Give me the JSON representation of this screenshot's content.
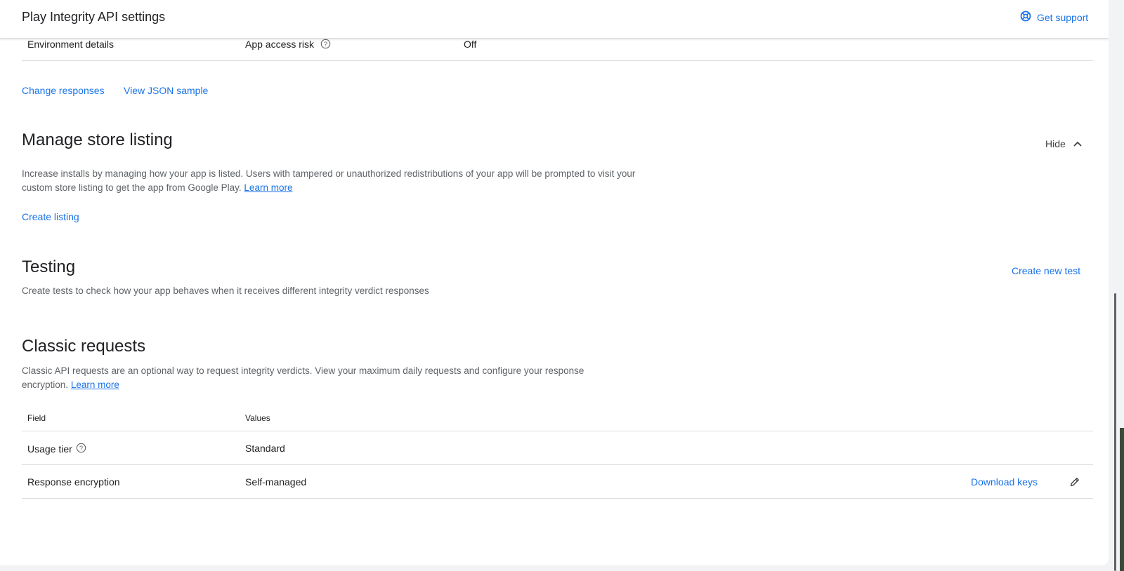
{
  "header": {
    "title": "Play Integrity API settings",
    "support_label": "Get support"
  },
  "responses_row": {
    "label": "Environment details",
    "field": "App access risk",
    "value": "Off"
  },
  "response_actions": {
    "change_label": "Change responses",
    "json_label": "View JSON sample"
  },
  "store_listing": {
    "title": "Manage store listing",
    "hide_label": "Hide",
    "description": "Increase installs by managing how your app is listed. Users with tampered or unauthorized redistributions of your app will be prompted to visit your custom store listing to get the app from Google Play.",
    "learn_more": "Learn more",
    "create_label": "Create listing"
  },
  "testing": {
    "title": "Testing",
    "description": "Create tests to check how your app behaves when it receives different integrity verdict responses",
    "create_label": "Create new test"
  },
  "classic": {
    "title": "Classic requests",
    "description": "Classic API requests are an optional way to request integrity verdicts. View your maximum daily requests and configure your response encryption.",
    "learn_more": "Learn more",
    "table": {
      "headers": [
        "Field",
        "Values"
      ],
      "rows": [
        {
          "field": "Usage tier",
          "value": "Standard"
        },
        {
          "field": "Response encryption",
          "value": "Self-managed",
          "action": "Download keys"
        }
      ]
    }
  },
  "colors": {
    "accent": "#1a73e8",
    "text": "#202124",
    "secondary_text": "#5f6368",
    "divider": "#dadce0"
  },
  "icons": [
    "lifebuoy-icon",
    "help-circle-icon",
    "chevron-up-icon",
    "pencil-icon"
  ]
}
